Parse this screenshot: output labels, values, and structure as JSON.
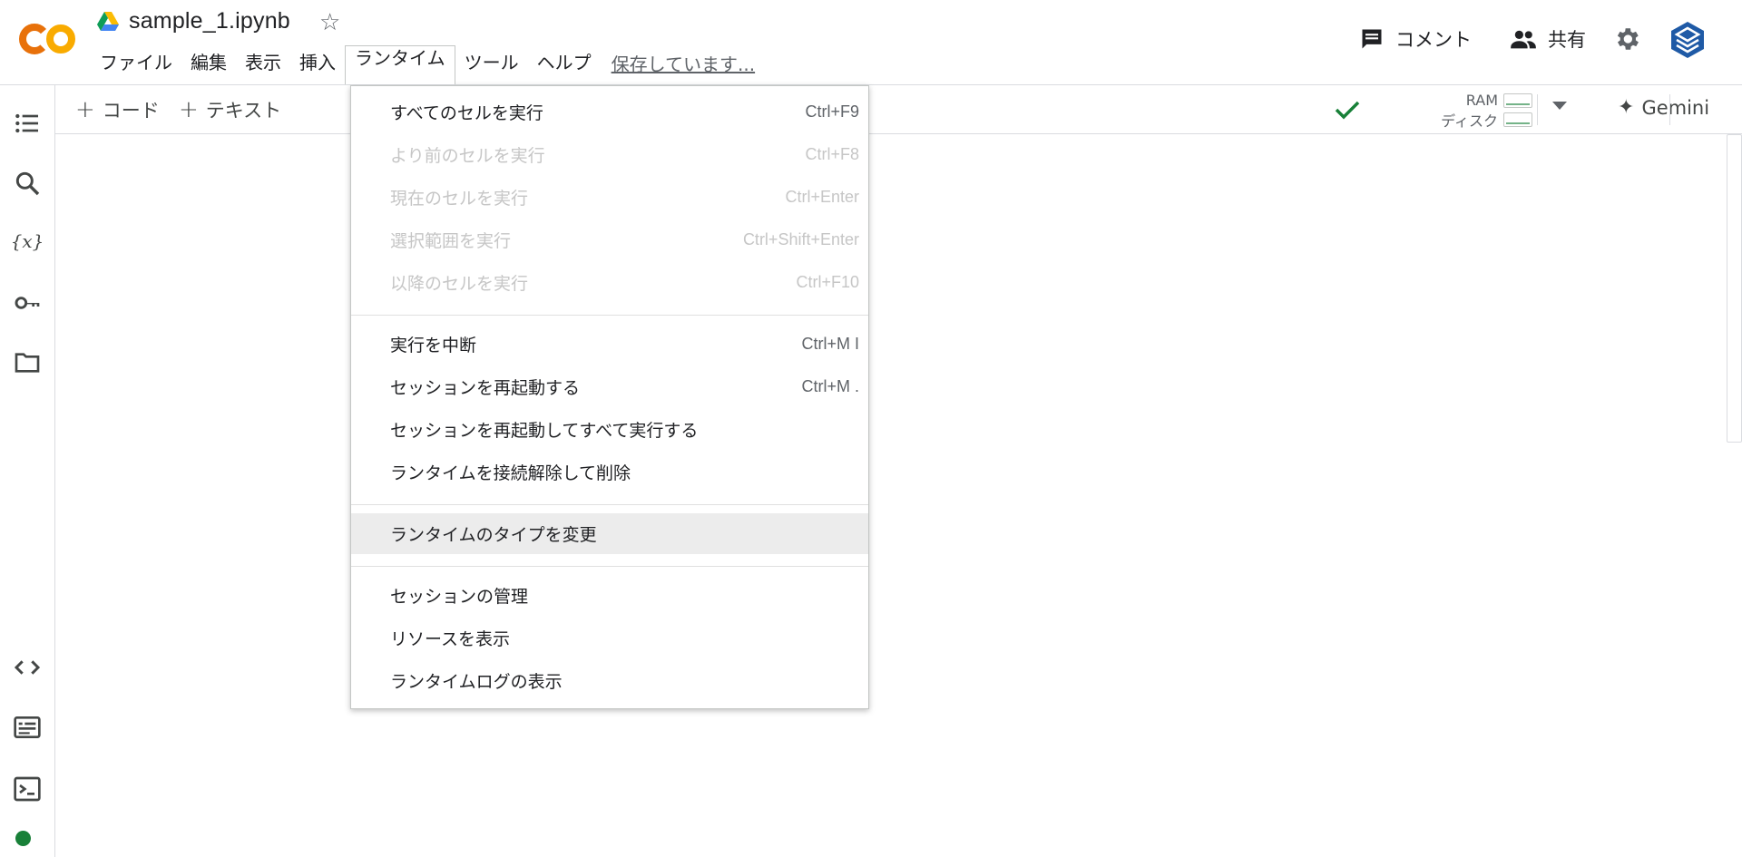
{
  "header": {
    "doc_title": "sample_1.ipynb",
    "menu": [
      "ファイル",
      "編集",
      "表示",
      "挿入",
      "ランタイム",
      "ツール",
      "ヘルプ"
    ],
    "active_menu_index": 4,
    "saving_status": "保存しています...",
    "comment_label": "コメント",
    "share_label": "共有"
  },
  "toolbar": {
    "add_code_label": "コード",
    "add_text_label": "テキスト",
    "ram_label": "RAM",
    "disk_label": "ディスク",
    "gemini_label": "Gemini"
  },
  "runtime_menu": {
    "groups": [
      [
        {
          "label": "すべてのセルを実行",
          "shortcut": "Ctrl+F9",
          "enabled": true
        },
        {
          "label": "より前のセルを実行",
          "shortcut": "Ctrl+F8",
          "enabled": false
        },
        {
          "label": "現在のセルを実行",
          "shortcut": "Ctrl+Enter",
          "enabled": false
        },
        {
          "label": "選択範囲を実行",
          "shortcut": "Ctrl+Shift+Enter",
          "enabled": false
        },
        {
          "label": "以降のセルを実行",
          "shortcut": "Ctrl+F10",
          "enabled": false
        }
      ],
      [
        {
          "label": "実行を中断",
          "shortcut": "Ctrl+M I",
          "enabled": true
        },
        {
          "label": "セッションを再起動する",
          "shortcut": "Ctrl+M .",
          "enabled": true
        },
        {
          "label": "セッションを再起動してすべて実行する",
          "shortcut": "",
          "enabled": true
        },
        {
          "label": "ランタイムを接続解除して削除",
          "shortcut": "",
          "enabled": true
        }
      ],
      [
        {
          "label": "ランタイムのタイプを変更",
          "shortcut": "",
          "enabled": true,
          "highlighted": true
        }
      ],
      [
        {
          "label": "セッションの管理",
          "shortcut": "",
          "enabled": true
        },
        {
          "label": "リソースを表示",
          "shortcut": "",
          "enabled": true
        },
        {
          "label": "ランタイムログの表示",
          "shortcut": "",
          "enabled": true
        }
      ]
    ]
  },
  "colors": {
    "logo_orange": "#f9ab00",
    "logo_orange_dark": "#e8710a",
    "status_green": "#188038",
    "avatar_blue": "#1f5aa6"
  },
  "icons": [
    "drive-icon",
    "star-icon",
    "comment-icon",
    "people-icon",
    "gear-icon",
    "toc-icon",
    "search-icon",
    "variables-icon",
    "key-icon",
    "folder-icon",
    "code-snippets-icon",
    "command-palette-icon",
    "terminal-icon",
    "check-icon",
    "chevron-up-icon",
    "sparkle-icon"
  ]
}
